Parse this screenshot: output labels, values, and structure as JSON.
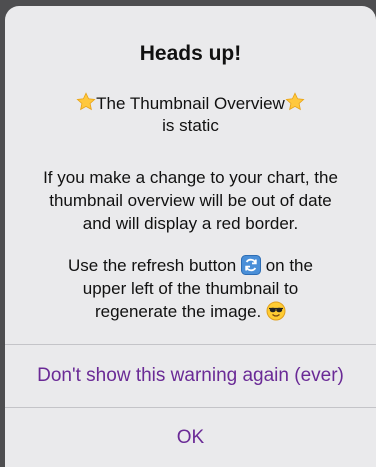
{
  "dialog": {
    "title": "Heads up!",
    "subtitle_line1": "The Thumbnail Overview",
    "subtitle_line2": "is static",
    "para1_line1": "If you make a change to your chart, the",
    "para1_line2": "thumbnail overview will be out of date",
    "para1_line3": "and will display a red border.",
    "para2_line1_a": "Use the refresh button",
    "para2_line1_b": "on the",
    "para2_line2": "upper left of the thumbnail to",
    "para2_line3": "regenerate the image.",
    "icons": [
      "star-icon",
      "refresh-icon",
      "sunglasses-emoji-icon"
    ]
  },
  "actions": {
    "dont_show": "Don't show this warning again (ever)",
    "ok": "OK"
  },
  "colors": {
    "accent": "#6a2a96",
    "dialog_bg": "#eaeaec",
    "backdrop": "#4e4e50"
  }
}
